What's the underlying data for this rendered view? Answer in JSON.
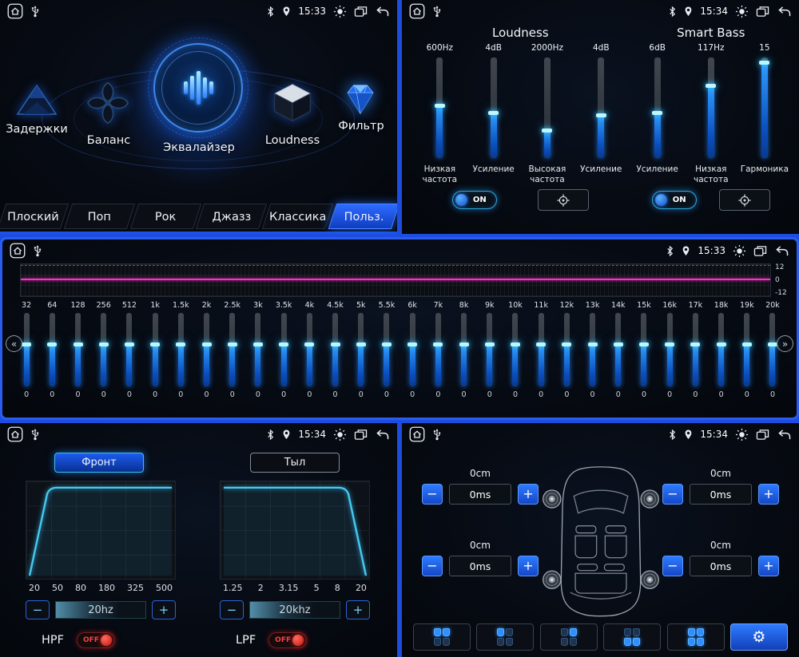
{
  "symbols": {
    "minus": "−",
    "plus": "+",
    "chevron_left": "«",
    "chevron_right": "»",
    "gear": "⚙"
  },
  "main": {
    "time": "15:33",
    "items": [
      {
        "label": "Задержки"
      },
      {
        "label": "Баланс"
      },
      {
        "label": "Эквалайзер"
      },
      {
        "label": "Loudness"
      },
      {
        "label": "Фильтр"
      }
    ],
    "presets": [
      {
        "label": "Плоский",
        "active": false
      },
      {
        "label": "Поп",
        "active": false
      },
      {
        "label": "Рок",
        "active": false
      },
      {
        "label": "Джазз",
        "active": false
      },
      {
        "label": "Классика",
        "active": false
      },
      {
        "label": "Польз.",
        "active": true
      }
    ]
  },
  "loudness": {
    "time": "15:34",
    "sections": [
      {
        "title": "Loudness",
        "toggle": "ON",
        "sliders": [
          {
            "value": "600Hz",
            "label": "Низкая частота",
            "level": 0.52
          },
          {
            "value": "4dB",
            "label": "Усиление",
            "level": 0.45
          },
          {
            "value": "2000Hz",
            "label": "Высокая частота",
            "level": 0.28
          },
          {
            "value": "4dB",
            "label": "Усиление",
            "level": 0.43
          }
        ]
      },
      {
        "title": "Smart Bass",
        "toggle": "ON",
        "sliders": [
          {
            "value": "6dB",
            "label": "Усиление",
            "level": 0.45
          },
          {
            "value": "117Hz",
            "label": "Низкая частота",
            "level": 0.72
          },
          {
            "value": "15",
            "label": "Гармоника",
            "level": 0.95
          }
        ]
      }
    ]
  },
  "eq": {
    "time": "15:33",
    "scale": [
      "12",
      "0",
      "-12"
    ],
    "bands": [
      {
        "freq": "32",
        "value": "0",
        "level": 0.58
      },
      {
        "freq": "64",
        "value": "0",
        "level": 0.58
      },
      {
        "freq": "128",
        "value": "0",
        "level": 0.58
      },
      {
        "freq": "256",
        "value": "0",
        "level": 0.58
      },
      {
        "freq": "512",
        "value": "0",
        "level": 0.58
      },
      {
        "freq": "1k",
        "value": "0",
        "level": 0.58
      },
      {
        "freq": "1.5k",
        "value": "0",
        "level": 0.58
      },
      {
        "freq": "2k",
        "value": "0",
        "level": 0.58
      },
      {
        "freq": "2.5k",
        "value": "0",
        "level": 0.58
      },
      {
        "freq": "3k",
        "value": "0",
        "level": 0.58
      },
      {
        "freq": "3.5k",
        "value": "0",
        "level": 0.58
      },
      {
        "freq": "4k",
        "value": "0",
        "level": 0.58
      },
      {
        "freq": "4.5k",
        "value": "0",
        "level": 0.58
      },
      {
        "freq": "5k",
        "value": "0",
        "level": 0.58
      },
      {
        "freq": "5.5k",
        "value": "0",
        "level": 0.58
      },
      {
        "freq": "6k",
        "value": "0",
        "level": 0.58
      },
      {
        "freq": "7k",
        "value": "0",
        "level": 0.58
      },
      {
        "freq": "8k",
        "value": "0",
        "level": 0.58
      },
      {
        "freq": "9k",
        "value": "0",
        "level": 0.58
      },
      {
        "freq": "10k",
        "value": "0",
        "level": 0.58
      },
      {
        "freq": "11k",
        "value": "0",
        "level": 0.58
      },
      {
        "freq": "12k",
        "value": "0",
        "level": 0.58
      },
      {
        "freq": "13k",
        "value": "0",
        "level": 0.58
      },
      {
        "freq": "14k",
        "value": "0",
        "level": 0.58
      },
      {
        "freq": "15k",
        "value": "0",
        "level": 0.58
      },
      {
        "freq": "16k",
        "value": "0",
        "level": 0.58
      },
      {
        "freq": "17k",
        "value": "0",
        "level": 0.58
      },
      {
        "freq": "18k",
        "value": "0",
        "level": 0.58
      },
      {
        "freq": "19k",
        "value": "0",
        "level": 0.58
      },
      {
        "freq": "20k",
        "value": "0",
        "level": 0.58
      }
    ]
  },
  "filters": {
    "time": "15:34",
    "tabs": [
      {
        "label": "Фронт",
        "active": true
      },
      {
        "label": "Тыл",
        "active": false
      }
    ],
    "hpf": {
      "label": "HPF",
      "value": "20hz",
      "state": "OFF",
      "scale": [
        "20",
        "50",
        "80",
        "180",
        "325",
        "500"
      ]
    },
    "lpf": {
      "label": "LPF",
      "value": "20khz",
      "state": "OFF",
      "scale": [
        "1.25",
        "2",
        "3.15",
        "5",
        "8",
        "20"
      ]
    }
  },
  "delays": {
    "time": "15:34",
    "corners": [
      {
        "cm": "0cm",
        "ms": "0ms"
      },
      {
        "cm": "0cm",
        "ms": "0ms"
      },
      {
        "cm": "0cm",
        "ms": "0ms"
      },
      {
        "cm": "0cm",
        "ms": "0ms"
      }
    ],
    "presets": [
      {
        "icon": "seats-front-pair"
      },
      {
        "icon": "seat-driver"
      },
      {
        "icon": "seat-passenger"
      },
      {
        "icon": "seats-rear"
      },
      {
        "icon": "seats-all"
      },
      {
        "icon": "settings-gear"
      }
    ]
  }
}
